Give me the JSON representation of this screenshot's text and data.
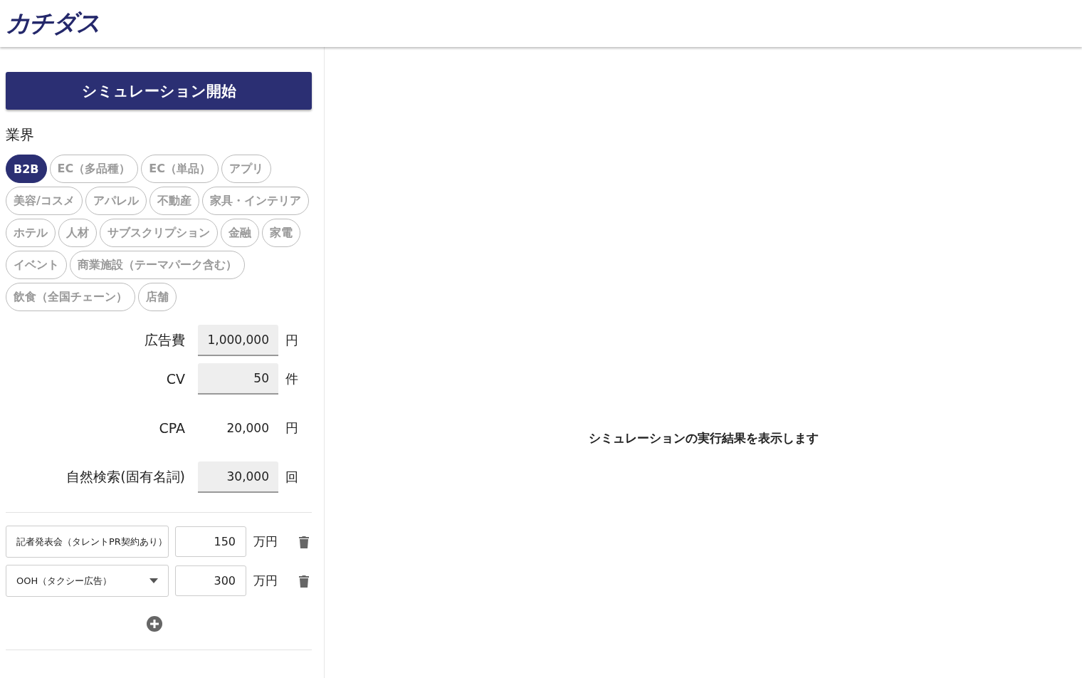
{
  "header": {
    "logo": "カチダス"
  },
  "sidebar": {
    "start_button": "シミュレーション開始",
    "industry_label": "業界",
    "industries": [
      {
        "label": "B2B",
        "selected": true
      },
      {
        "label": "EC（多品種）",
        "selected": false
      },
      {
        "label": "EC（単品）",
        "selected": false
      },
      {
        "label": "アプリ",
        "selected": false
      },
      {
        "label": "美容/コスメ",
        "selected": false
      },
      {
        "label": "アパレル",
        "selected": false
      },
      {
        "label": "不動産",
        "selected": false
      },
      {
        "label": "家具・インテリア",
        "selected": false
      },
      {
        "label": "ホテル",
        "selected": false
      },
      {
        "label": "人材",
        "selected": false
      },
      {
        "label": "サブスクリプション",
        "selected": false
      },
      {
        "label": "金融",
        "selected": false
      },
      {
        "label": "家電",
        "selected": false
      },
      {
        "label": "イベント",
        "selected": false
      },
      {
        "label": "商業施設（テーマパーク含む）",
        "selected": false
      },
      {
        "label": "飲食（全国チェーン）",
        "selected": false
      },
      {
        "label": "店舗",
        "selected": false
      }
    ],
    "metrics": [
      {
        "kind": "input",
        "label": "広告費",
        "value": "1,000,000",
        "unit": "円"
      },
      {
        "kind": "input",
        "label": "CV",
        "value": "50",
        "unit": "件"
      },
      {
        "kind": "readonly",
        "label": "CPA",
        "value": "20,000",
        "unit": "円"
      },
      {
        "kind": "input",
        "label": "自然検索(固有名詞)",
        "value": "30,000",
        "unit": "回"
      }
    ],
    "measures": [
      {
        "kind": "text",
        "name": "記者発表会（タレントPR契約あり）",
        "amount": "150",
        "unit": "万円"
      },
      {
        "kind": "select",
        "name": "OOH（タクシー広告）",
        "amount": "300",
        "unit": "万円"
      }
    ]
  },
  "result": {
    "message": "シミュレーションの実行結果を表示します"
  }
}
